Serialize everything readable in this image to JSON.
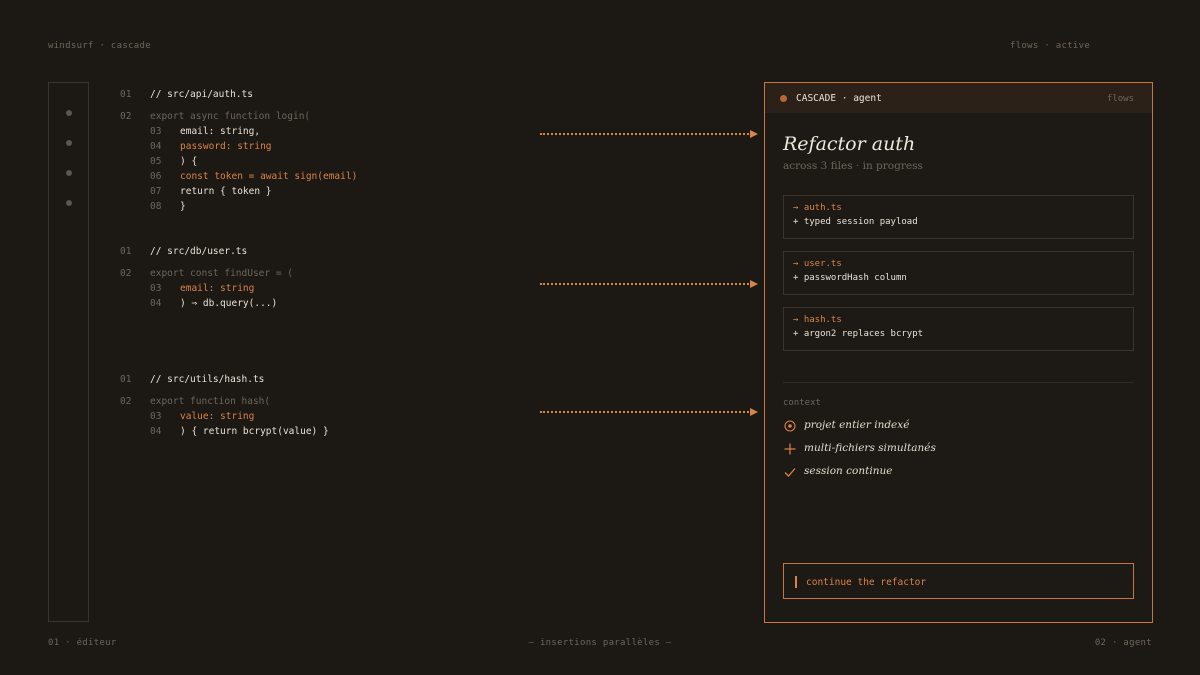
{
  "corners": {
    "top_left": "windsurf · cascade",
    "top_right": "flows · active",
    "bottom_left": "01 · éditeur",
    "bottom_center": "— insertions parallèles —",
    "bottom_right": "02 · agent"
  },
  "editor": {
    "blocks": [
      {
        "header_ln": "01",
        "header": "// src/api/auth.ts",
        "sig_ln": "02",
        "sig": "export async function login(",
        "lines": [
          {
            "ln": "03",
            "text": "email: string,",
            "tone": "normal"
          },
          {
            "ln": "04",
            "text": "password: string",
            "tone": "accent"
          },
          {
            "ln": "05",
            "text": ") {",
            "tone": "normal"
          },
          {
            "ln": "06",
            "text": "const token = await sign(email)",
            "tone": "accent"
          },
          {
            "ln": "07",
            "text": "return { token }",
            "tone": "normal"
          },
          {
            "ln": "08",
            "text": "}",
            "tone": "normal"
          }
        ]
      },
      {
        "header_ln": "01",
        "header": "// src/db/user.ts",
        "sig_ln": "02",
        "sig": "export const findUser = (",
        "lines": [
          {
            "ln": "03",
            "text": "email: string",
            "tone": "accent"
          },
          {
            "ln": "04",
            "text": ") ⇒ db.query(...)",
            "tone": "normal"
          }
        ]
      },
      {
        "header_ln": "01",
        "header": "// src/utils/hash.ts",
        "sig_ln": "02",
        "sig": "export function hash(",
        "lines": [
          {
            "ln": "03",
            "text": "value: string",
            "tone": "accent"
          },
          {
            "ln": "04",
            "text": ") { return bcrypt(value) }",
            "tone": "normal"
          }
        ]
      }
    ]
  },
  "panel": {
    "header_title": "CASCADE · agent",
    "header_right": "flows",
    "title": "Refactor auth",
    "subtitle": "across 3 files · in progress",
    "changes": [
      {
        "file": "→ auth.ts",
        "change": "+ typed session payload"
      },
      {
        "file": "→ user.ts",
        "change": "+ passwordHash column"
      },
      {
        "file": "→ hash.ts",
        "change": "+ argon2 replaces bcrypt"
      }
    ],
    "context_label": "context",
    "context_items": [
      {
        "icon": "target-icon",
        "text": "projet entier indexé"
      },
      {
        "icon": "plus-icon",
        "text": "multi-fichiers simultanés"
      },
      {
        "icon": "check-icon",
        "text": "session continue"
      }
    ],
    "prompt": "continue the refactor"
  },
  "colors": {
    "background": "#1c1814",
    "accent": "#d9844a",
    "muted": "#6e665c",
    "text": "#e8e2d8"
  }
}
